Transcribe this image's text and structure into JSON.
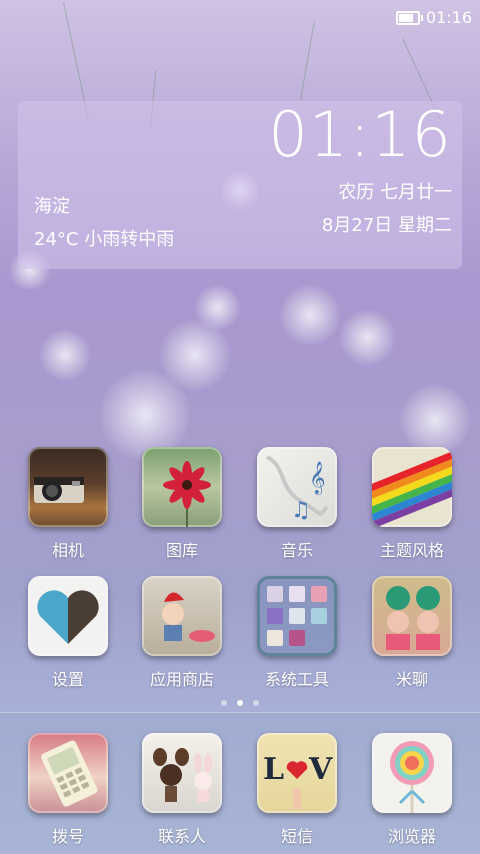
{
  "status_bar": {
    "time": "01:16"
  },
  "widget": {
    "clock": "01:16",
    "lunar": "农历 七月廿一",
    "date": "8月27日 星期二",
    "city": "海淀",
    "weather": "24°C 小雨转中雨"
  },
  "apps": [
    {
      "label": "相机",
      "icon": "camera-icon"
    },
    {
      "label": "图库",
      "icon": "gallery-icon"
    },
    {
      "label": "音乐",
      "icon": "music-icon"
    },
    {
      "label": "主题风格",
      "icon": "theme-icon"
    },
    {
      "label": "设置",
      "icon": "settings-icon"
    },
    {
      "label": "应用商店",
      "icon": "app-store-icon"
    },
    {
      "label": "系统工具",
      "icon": "system-tools-icon"
    },
    {
      "label": "米聊",
      "icon": "miliao-icon"
    }
  ],
  "pager": {
    "count": 3,
    "active": 2
  },
  "dock": [
    {
      "label": "拨号",
      "icon": "phone-icon"
    },
    {
      "label": "联系人",
      "icon": "contacts-icon"
    },
    {
      "label": "短信",
      "icon": "messages-icon"
    },
    {
      "label": "浏览器",
      "icon": "browser-icon"
    }
  ]
}
